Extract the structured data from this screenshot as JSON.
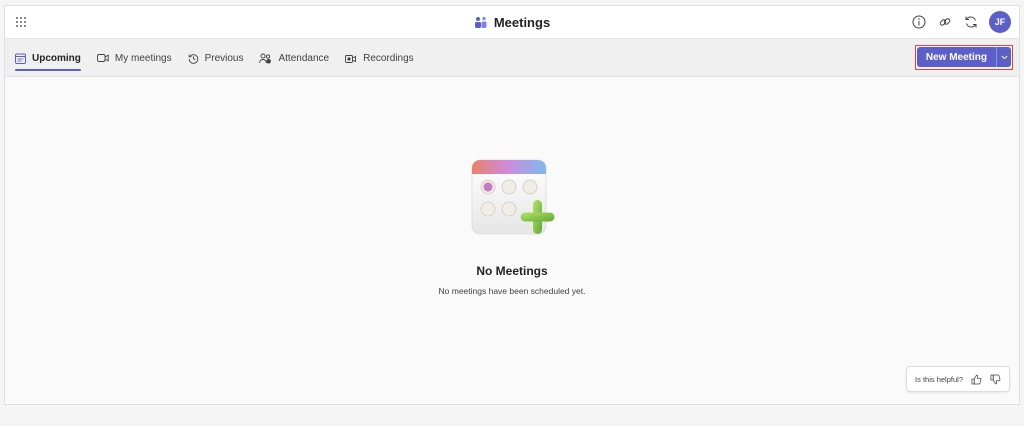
{
  "header": {
    "title": "Meetings",
    "avatar_initials": "JF"
  },
  "tabs": [
    {
      "label": "Upcoming",
      "icon": "calendar-icon",
      "active": true
    },
    {
      "label": "My meetings",
      "icon": "video-icon",
      "active": false
    },
    {
      "label": "Previous",
      "icon": "history-icon",
      "active": false
    },
    {
      "label": "Attendance",
      "icon": "people-icon",
      "active": false
    },
    {
      "label": "Recordings",
      "icon": "recording-icon",
      "active": false
    }
  ],
  "actions": {
    "new_meeting_label": "New Meeting"
  },
  "empty_state": {
    "title": "No Meetings",
    "subtitle": "No meetings have been scheduled yet."
  },
  "feedback": {
    "prompt": "Is this helpful?"
  },
  "colors": {
    "accent": "#5b5fc7",
    "highlight_border": "#e0443c"
  }
}
